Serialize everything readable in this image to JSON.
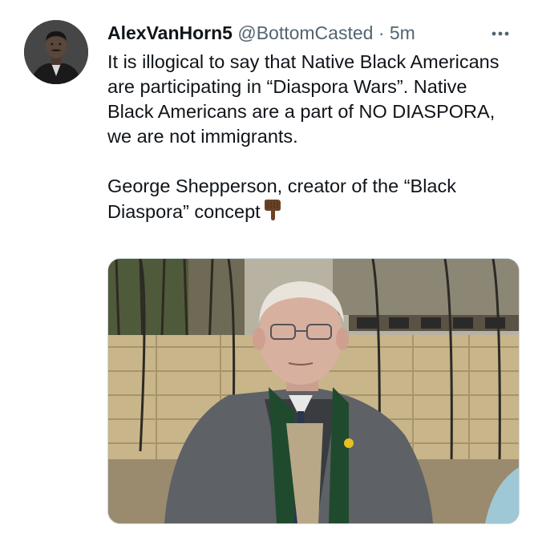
{
  "tweet": {
    "author": {
      "display_name": "AlexVanHorn5",
      "handle": "@BottomCasted",
      "separator": "·",
      "time": "5m",
      "avatar_icon": "profile-photo"
    },
    "more_icon": "more-horizontal-icon",
    "paragraphs": [
      "It is illogical to say that Native Black Americans are participating in “Diaspora Wars”. Native Black Americans are a part of NO DIASPORA, we are not immigrants.",
      "George Shepperson, creator of the “Black Diaspora” concept"
    ],
    "emoji": "backhand-index-pointing-down-emoji",
    "media": {
      "type": "photo",
      "subject": "photo-elderly-man-in-coat"
    },
    "colors": {
      "text": "#0f1419",
      "secondary": "#536471",
      "border": "#cfd9de"
    }
  }
}
